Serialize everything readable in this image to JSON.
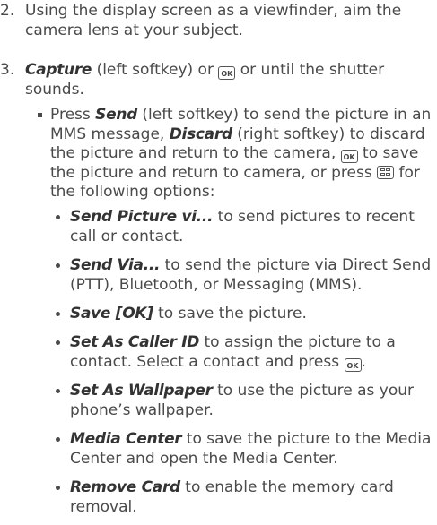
{
  "steps": [
    {
      "number": "2.",
      "text": "Using the display screen as a viewfinder, aim the camera lens at your subject."
    },
    {
      "number": "3.",
      "p1_bold": "Capture",
      "p1_rest": " (left softkey) or ",
      "p1_end": " or until the shutter sounds."
    }
  ],
  "sub": {
    "send_bold": "Send",
    "t1": " (left softkey) to send the picture in an MMS message, ",
    "discard_bold": "Discard",
    "t2": " (right softkey) to discard the picture and return to the camera, ",
    "t3": " to save the picture and return to camera, or press ",
    "t4": " for the following options:"
  },
  "keys": {
    "ok": "OK",
    "menu": "menu-key-icon"
  },
  "options": [
    {
      "name": "Send Picture vi...",
      "desc": " to send pictures to recent call or contact."
    },
    {
      "name": "Send Via...",
      "desc": " to send the picture via Direct Send (PTT), Bluetooth, or Messaging (MMS)."
    },
    {
      "name": "Save [OK]",
      "desc": " to save the picture."
    },
    {
      "name": "Set As Caller ID",
      "desc": " to assign the picture to a contact. Select a contact and press "
    },
    {
      "name": "Set As Wallpaper",
      "desc": " to use the picture as your phone’s wallpaper."
    },
    {
      "name": "Media Center",
      "desc": " to save the picture to the Media Center and open the Media Center."
    },
    {
      "name": "Remove Card",
      "desc": " to enable the memory card removal."
    }
  ],
  "sub_prefix": "Press "
}
